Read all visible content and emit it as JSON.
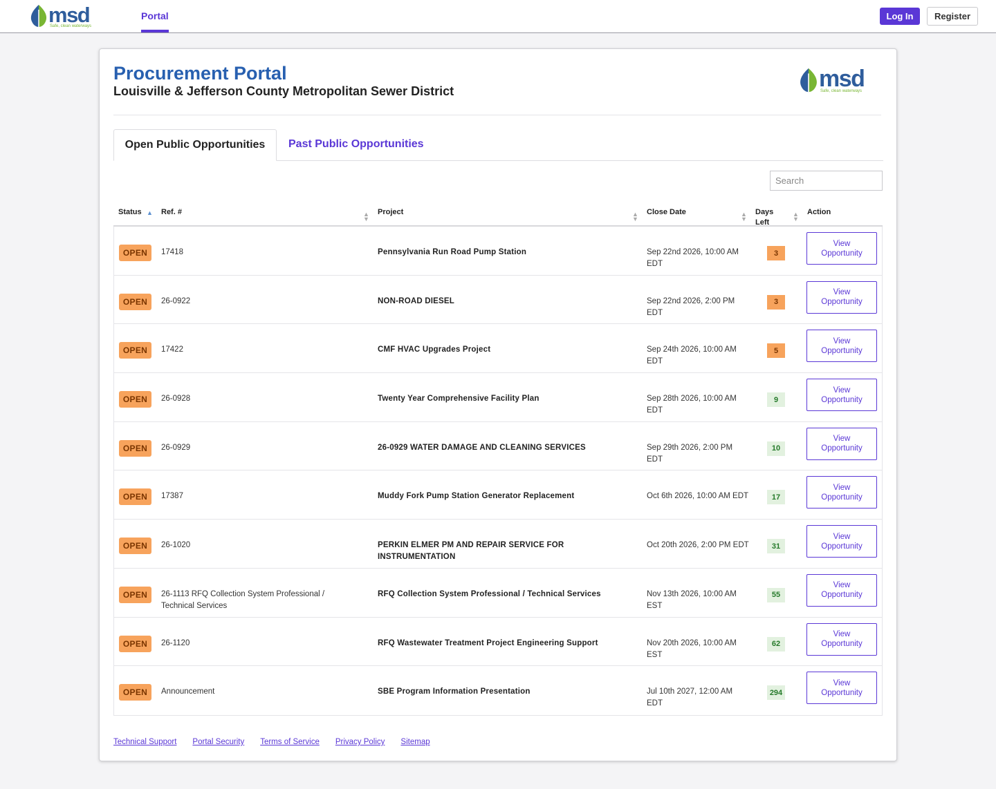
{
  "nav": {
    "logo_word": "msd",
    "logo_tagline": "Safe, clean waterways",
    "tab_label": "Portal",
    "login_label": "Log In",
    "register_label": "Register"
  },
  "header": {
    "title": "Procurement Portal",
    "subtitle": "Louisville & Jefferson County Metropolitan Sewer District",
    "logo_word": "msd",
    "logo_tagline": "Safe, clean waterways"
  },
  "tabs": {
    "open_label": "Open Public Opportunities",
    "past_label": "Past Public Opportunities"
  },
  "search": {
    "placeholder": "Search"
  },
  "table": {
    "columns": {
      "status": "Status",
      "ref": "Ref. #",
      "project": "Project",
      "close_date": "Close Date",
      "days_left": "Days Left",
      "action": "Action"
    },
    "rows": [
      {
        "status": "OPEN",
        "ref": "17418",
        "project": "Pennsylvania Run Road Pump Station",
        "close_date": "Sep 22nd 2026, 10:00 AM EDT",
        "days_left": "3",
        "action": "View Opportunity"
      },
      {
        "status": "OPEN",
        "ref": "26-0922",
        "project": "NON-ROAD DIESEL",
        "close_date": "Sep 22nd 2026, 2:00 PM EDT",
        "days_left": "3",
        "action": "View Opportunity"
      },
      {
        "status": "OPEN",
        "ref": "17422",
        "project": "CMF HVAC Upgrades Project",
        "close_date": "Sep 24th 2026, 10:00 AM EDT",
        "days_left": "5",
        "action": "View Opportunity"
      },
      {
        "status": "OPEN",
        "ref": "26-0928",
        "project": "Twenty Year Comprehensive Facility Plan",
        "close_date": "Sep 28th 2026, 10:00 AM EDT",
        "days_left": "9",
        "action": "View Opportunity"
      },
      {
        "status": "OPEN",
        "ref": "26-0929",
        "project": "26-0929 WATER DAMAGE AND CLEANING SERVICES",
        "close_date": "Sep 29th 2026, 2:00 PM EDT",
        "days_left": "10",
        "action": "View Opportunity"
      },
      {
        "status": "OPEN",
        "ref": "17387",
        "project": "Muddy Fork Pump Station Generator Replacement",
        "close_date": "Oct 6th 2026, 10:00 AM EDT",
        "days_left": "17",
        "action": "View Opportunity"
      },
      {
        "status": "OPEN",
        "ref": "26-1020",
        "project": "PERKIN ELMER PM AND REPAIR SERVICE FOR INSTRUMENTATION",
        "close_date": "Oct 20th 2026, 2:00 PM EDT",
        "days_left": "31",
        "action": "View Opportunity"
      },
      {
        "status": "OPEN",
        "ref": "26-1113 RFQ Collection System Professional / Technical Services",
        "project": "RFQ Collection System Professional / Technical Services",
        "close_date": "Nov 13th 2026, 10:00 AM EST",
        "days_left": "55",
        "action": "View Opportunity"
      },
      {
        "status": "OPEN",
        "ref": "26-1120",
        "project": "RFQ Wastewater Treatment Project Engineering Support",
        "close_date": "Nov 20th 2026, 10:00 AM EST",
        "days_left": "62",
        "action": "View Opportunity"
      },
      {
        "status": "OPEN",
        "ref": "Announcement",
        "project": "SBE Program Information Presentation",
        "close_date": "Jul 10th 2027, 12:00 AM EDT",
        "days_left": "294",
        "action": "View Opportunity"
      }
    ]
  },
  "footer": {
    "links": [
      "Technical Support",
      "Portal Security",
      "Terms of Service",
      "Privacy Policy",
      "Sitemap"
    ]
  },
  "colors": {
    "brand_blue": "#2860b0",
    "accent_purple": "#5a37d6",
    "open_badge": "#f7a35c",
    "days_warn": "#f7a35c",
    "days_ok": "#e2f1df",
    "logo_green": "#79b634"
  },
  "icons": [
    "msd-leaf-logo",
    "sort-asc-icon",
    "sort-both-icon"
  ]
}
